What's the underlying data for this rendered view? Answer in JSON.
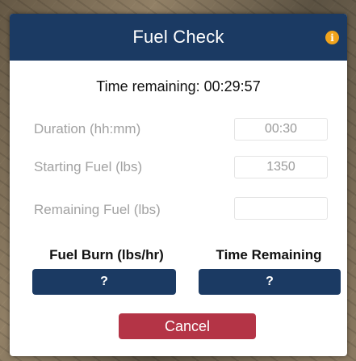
{
  "dialog": {
    "title": "Fuel Check",
    "info_icon": "info-icon"
  },
  "time_remaining": "Time remaining: 00:29:57",
  "fields": [
    {
      "label": "Duration (hh:mm)",
      "value": "00:30"
    },
    {
      "label": "Starting Fuel (lbs)",
      "value": "1350"
    },
    {
      "label": "Remaining Fuel (lbs)",
      "value": ""
    }
  ],
  "calculations": {
    "fuel_burn_label": "Fuel Burn (lbs/hr)",
    "fuel_burn_button": "?",
    "time_remaining_label": "Time Remaining",
    "time_remaining_button": "?"
  },
  "cancel_label": "Cancel",
  "colors": {
    "header": "#1b3a63",
    "info": "#f0a31c",
    "cancel": "#b43446"
  }
}
